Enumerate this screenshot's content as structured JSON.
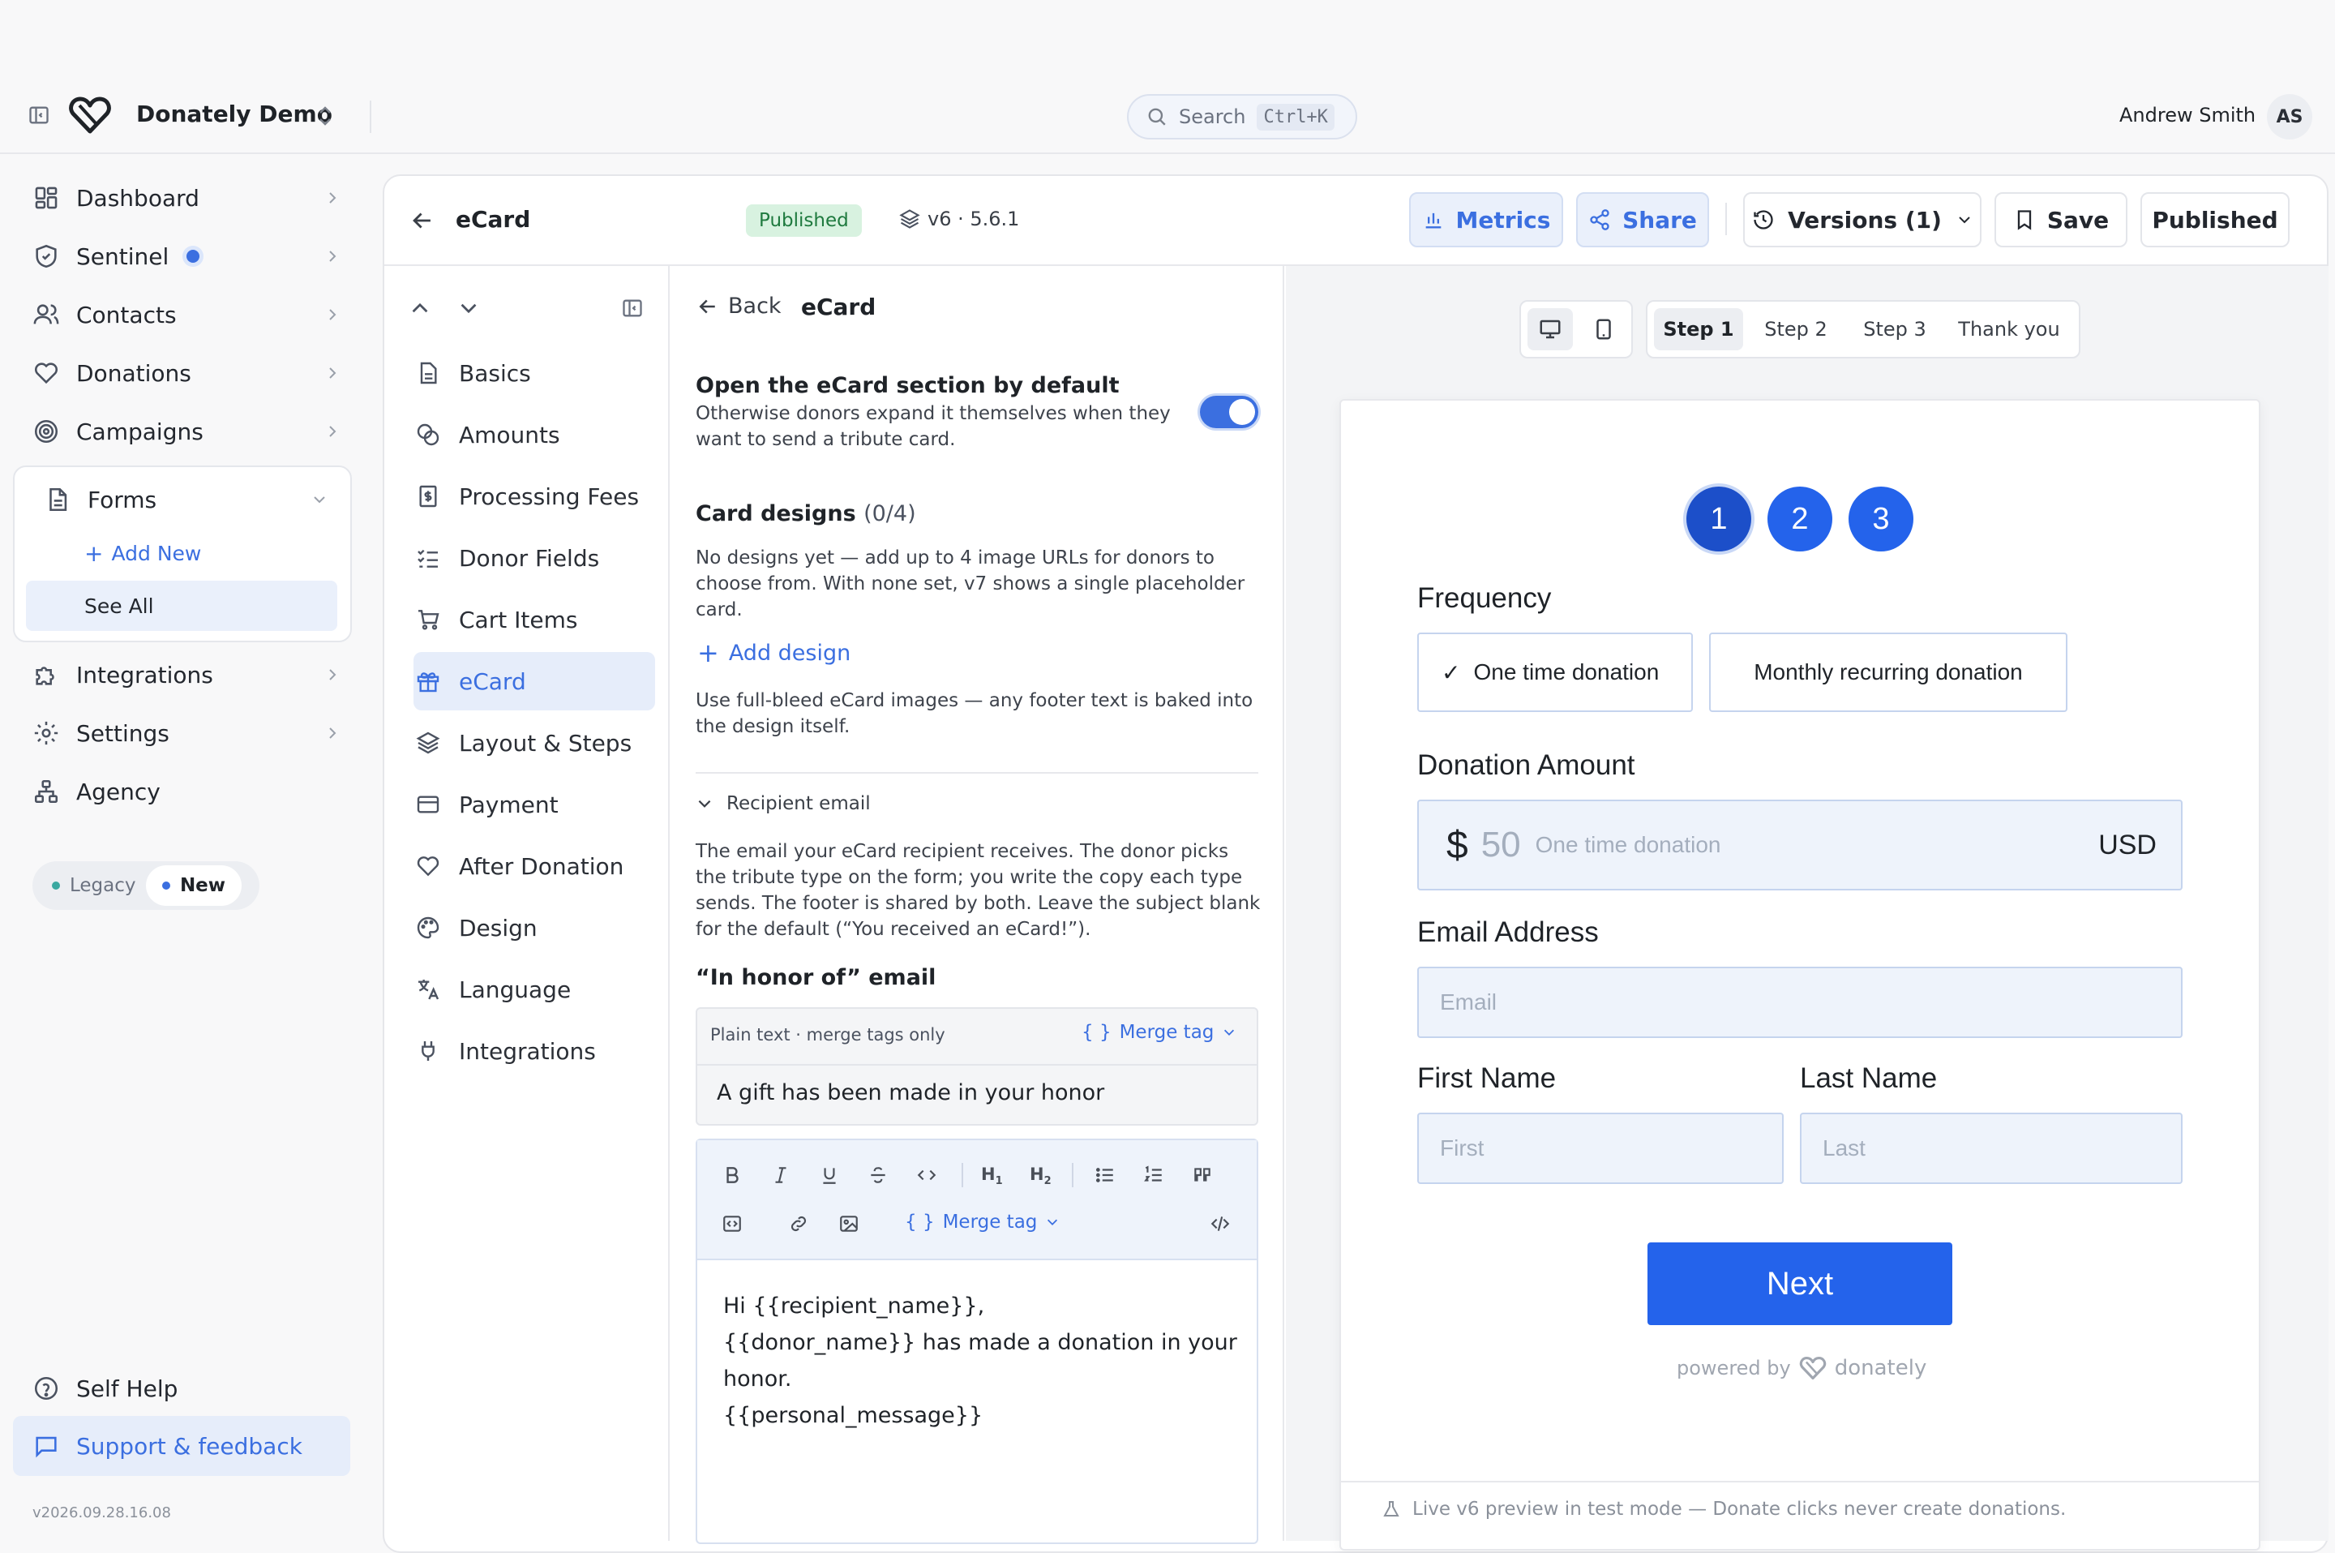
{
  "header": {
    "org_name": "Donately Demo",
    "search_placeholder": "Search",
    "search_shortcut": "Ctrl+K",
    "user_name": "Andrew Smith",
    "user_initials": "AS"
  },
  "sidebar": {
    "items": [
      {
        "label": "Dashboard",
        "icon": "grid-icon"
      },
      {
        "label": "Sentinel",
        "icon": "shield-icon"
      },
      {
        "label": "Contacts",
        "icon": "users-icon"
      },
      {
        "label": "Donations",
        "icon": "heart-icon"
      },
      {
        "label": "Campaigns",
        "icon": "target-icon"
      }
    ],
    "forms_label": "Forms",
    "forms_add_new": "Add New",
    "forms_see_all": "See All",
    "items_after": [
      {
        "label": "Integrations",
        "icon": "puzzle-icon"
      },
      {
        "label": "Settings",
        "icon": "gear-icon"
      },
      {
        "label": "Agency",
        "icon": "network-icon"
      }
    ],
    "toggle_legacy": "Legacy",
    "toggle_new": "New",
    "self_help": "Self Help",
    "support": "Support & feedback",
    "version": "v2026.09.28.16.08",
    "accent": "#3b6fe0"
  },
  "form_header": {
    "title": "eCard",
    "status_badge": "Published",
    "version_label": "v6 · 5.6.1",
    "metrics": "Metrics",
    "share": "Share",
    "versions": "Versions (1)",
    "save": "Save",
    "published": "Published"
  },
  "section_nav": {
    "items": [
      "Basics",
      "Amounts",
      "Processing Fees",
      "Donor Fields",
      "Cart Items",
      "eCard",
      "Layout & Steps",
      "Payment",
      "After Donation",
      "Design",
      "Language",
      "Integrations"
    ],
    "active": "eCard"
  },
  "editor": {
    "back": "Back",
    "title": "eCard",
    "open_default_title": "Open the eCard section by default",
    "open_default_desc": "Otherwise donors expand it themselves when they want to send a tribute card.",
    "open_default_on": true,
    "card_designs_title": "Card designs",
    "card_designs_count": "(0/4)",
    "card_designs_desc": "No designs yet — add up to 4 image URLs for donors to choose from. With none set, v7 shows a single placeholder card.",
    "add_design": "Add design",
    "full_bleed_note": "Use full-bleed eCard images — any footer text is baked into the design itself.",
    "recipient_email_label": "Recipient email",
    "recipient_email_desc": "The email your eCard recipient receives. The donor picks the tribute type on the form; you write the copy each type sends. The footer is shared by both. Leave the subject blank for the default (“You received an eCard!”).",
    "honor_email_title": "“In honor of” email",
    "subject_hint": "Plain text · merge tags only",
    "merge_tag": "Merge tag",
    "subject_value": "A gift has been made in your honor",
    "body_merge_tag": "Merge tag",
    "body_lines": [
      "Hi {{recipient_name}},",
      "{{donor_name}} has made a donation in your",
      "honor.",
      "{{personal_message}}"
    ]
  },
  "preview": {
    "steps": [
      "Step 1",
      "Step 2",
      "Step 3",
      "Thank you"
    ],
    "active_step": "Step 1",
    "step_circles": [
      "1",
      "2",
      "3"
    ],
    "frequency_label": "Frequency",
    "frequency_options": [
      "One time donation",
      "Monthly recurring donation"
    ],
    "frequency_check": "✓",
    "amount_label": "Donation Amount",
    "currency_symbol": "$",
    "amount_placeholder": "50",
    "amount_hint": "One time donation",
    "currency": "USD",
    "email_label": "Email Address",
    "email_placeholder": "Email",
    "first_name_label": "First Name",
    "first_placeholder": "First",
    "last_name_label": "Last Name",
    "last_placeholder": "Last",
    "next_button": "Next",
    "powered_by": "powered by",
    "brand": "donately",
    "footer_note": "Live v6 preview in test mode — Donate clicks never create donations.",
    "primary_color": "#2463eb",
    "step_dark": "#1c4fc9"
  }
}
